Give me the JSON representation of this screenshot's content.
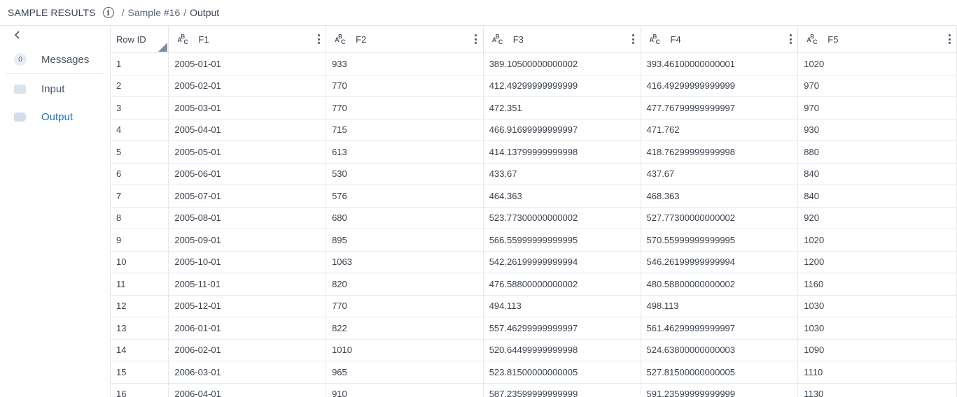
{
  "breadcrumb": {
    "title": "SAMPLE RESULTS",
    "info_icon": "info-icon",
    "sample": "Sample #16",
    "current": "Output",
    "separator": "/"
  },
  "sidebar": {
    "back_icon": "chevron-left-icon",
    "messages": {
      "label": "Messages",
      "count": "0"
    },
    "input": {
      "label": "Input",
      "icon": "square-icon"
    },
    "output": {
      "label": "Output",
      "icon": "tag-icon"
    },
    "active_color": "#1f6fb7"
  },
  "table": {
    "columns": [
      {
        "label": "Row ID",
        "type_icon": ""
      },
      {
        "label": "F1",
        "type_icon": "abc-icon"
      },
      {
        "label": "F2",
        "type_icon": "abc-icon"
      },
      {
        "label": "F3",
        "type_icon": "abc-icon"
      },
      {
        "label": "F4",
        "type_icon": "abc-icon"
      },
      {
        "label": "F5",
        "type_icon": "abc-icon"
      }
    ],
    "rows": [
      [
        "1",
        "2005-01-01",
        "933",
        "389.10500000000002",
        "393.46100000000001",
        "1020"
      ],
      [
        "2",
        "2005-02-01",
        "770",
        "412.49299999999999",
        "416.49299999999999",
        "970"
      ],
      [
        "3",
        "2005-03-01",
        "770",
        "472.351",
        "477.76799999999997",
        "970"
      ],
      [
        "4",
        "2005-04-01",
        "715",
        "466.91699999999997",
        "471.762",
        "930"
      ],
      [
        "5",
        "2005-05-01",
        "613",
        "414.13799999999998",
        "418.76299999999998",
        "880"
      ],
      [
        "6",
        "2005-06-01",
        "530",
        "433.67",
        "437.67",
        "840"
      ],
      [
        "7",
        "2005-07-01",
        "576",
        "464.363",
        "468.363",
        "840"
      ],
      [
        "8",
        "2005-08-01",
        "680",
        "523.77300000000002",
        "527.77300000000002",
        "920"
      ],
      [
        "9",
        "2005-09-01",
        "895",
        "566.55999999999995",
        "570.55999999999995",
        "1020"
      ],
      [
        "10",
        "2005-10-01",
        "1063",
        "542.26199999999994",
        "546.26199999999994",
        "1200"
      ],
      [
        "11",
        "2005-11-01",
        "820",
        "476.58800000000002",
        "480.58800000000002",
        "1160"
      ],
      [
        "12",
        "2005-12-01",
        "770",
        "494.113",
        "498.113",
        "1030"
      ],
      [
        "13",
        "2006-01-01",
        "822",
        "557.46299999999997",
        "561.46299999999997",
        "1030"
      ],
      [
        "14",
        "2006-02-01",
        "1010",
        "520.64499999999998",
        "524.63800000000003",
        "1090"
      ],
      [
        "15",
        "2006-03-01",
        "965",
        "523.81500000000005",
        "527.81500000000005",
        "1110"
      ],
      [
        "16",
        "2006-04-01",
        "910",
        "587.23599999999999",
        "591.23599999999999",
        "1130"
      ]
    ]
  }
}
